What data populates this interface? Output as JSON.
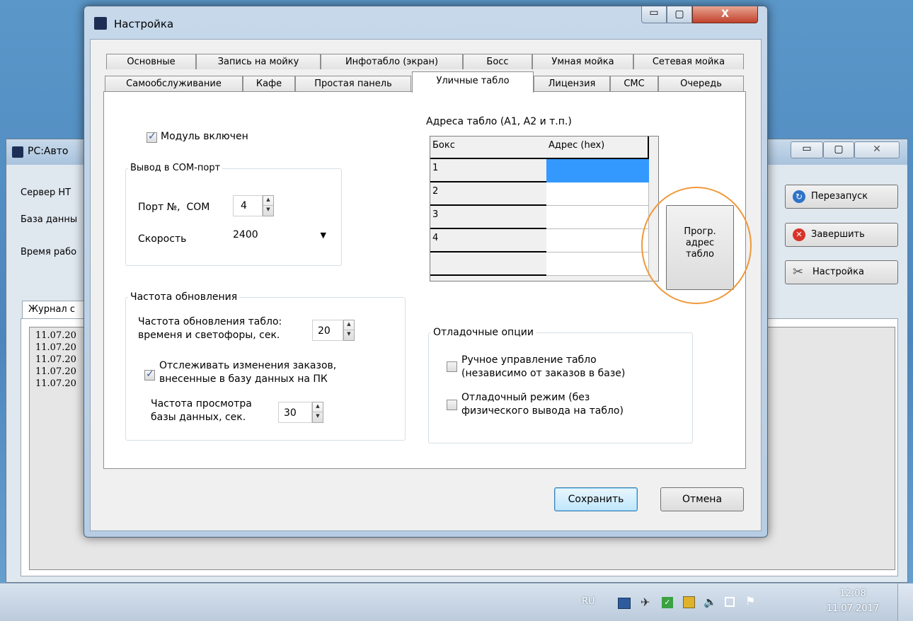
{
  "background_window": {
    "title": "PC:Авто",
    "labels": [
      "Сервер НТ",
      "База данны",
      "Время рабо"
    ],
    "tab": "Журнал с",
    "log_lines": [
      "11.07.20",
      "11.07.20",
      "11.07.20",
      "11.07.20",
      "11.07.20"
    ],
    "buttons": {
      "restart": "Перезапуск",
      "finish": "Завершить",
      "settings": "Настройка"
    }
  },
  "dialog": {
    "title": "Настройка",
    "tabs_row1": [
      "Основные",
      "Запись на мойку",
      "Инфотабло (экран)",
      "Босс",
      "Умная мойка",
      "Сетевая мойка"
    ],
    "tabs_row2": [
      "Самообслуживание",
      "Кафе",
      "Простая панель",
      "Уличные табло",
      "Лицензия",
      "СМС",
      "Очередь"
    ],
    "active_tab": "Уличные табло",
    "module_enabled": {
      "label": "Модуль включен",
      "checked": true
    },
    "com_group": {
      "title": "Вывод в СОМ-порт",
      "port_label": "Порт №,  СОМ",
      "port_value": "4",
      "speed_label": "Скорость",
      "speed_value": "2400"
    },
    "refresh_group": {
      "title": "Частота обновления",
      "refresh_label_1": "Частота обновления табло:",
      "refresh_label_2": "временя и светофоры, сек.",
      "refresh_value": "20",
      "track_label_1": "Отслеживать изменения заказов,",
      "track_label_2": "внесенные в базу данных на ПК",
      "track_checked": true,
      "db_label_1": "Частота просмотра",
      "db_label_2": "базы данных, сек.",
      "db_value": "30"
    },
    "addresses": {
      "title": "Адреса табло (А1, А2 и т.п.)",
      "col_box": "Бокс",
      "col_addr": "Адрес (hex)",
      "rows": [
        {
          "box": "1",
          "addr": ""
        },
        {
          "box": "2",
          "addr": ""
        },
        {
          "box": "3",
          "addr": ""
        },
        {
          "box": "4",
          "addr": ""
        },
        {
          "box": "",
          "addr": ""
        }
      ]
    },
    "prog_button": {
      "line1": "Прогр.",
      "line2": "адрес",
      "line3": "табло"
    },
    "debug_group": {
      "title": "Отладочные опции",
      "manual_1": "Ручное управление табло",
      "manual_2": "(независимо от заказов в базе)",
      "manual_checked": false,
      "debug_1": "Отладочный режим (без",
      "debug_2": "физического вывода на табло)",
      "debug_checked": false
    },
    "save_label": "Сохранить",
    "cancel_label": "Отмена"
  },
  "taskbar": {
    "lang": "RU",
    "time": "12:08",
    "date": "11.07.2017"
  },
  "colors": {
    "highlight_circle": "#f0983a",
    "selected_cell": "#3399ff",
    "taskbar": "#c9d6e4"
  }
}
